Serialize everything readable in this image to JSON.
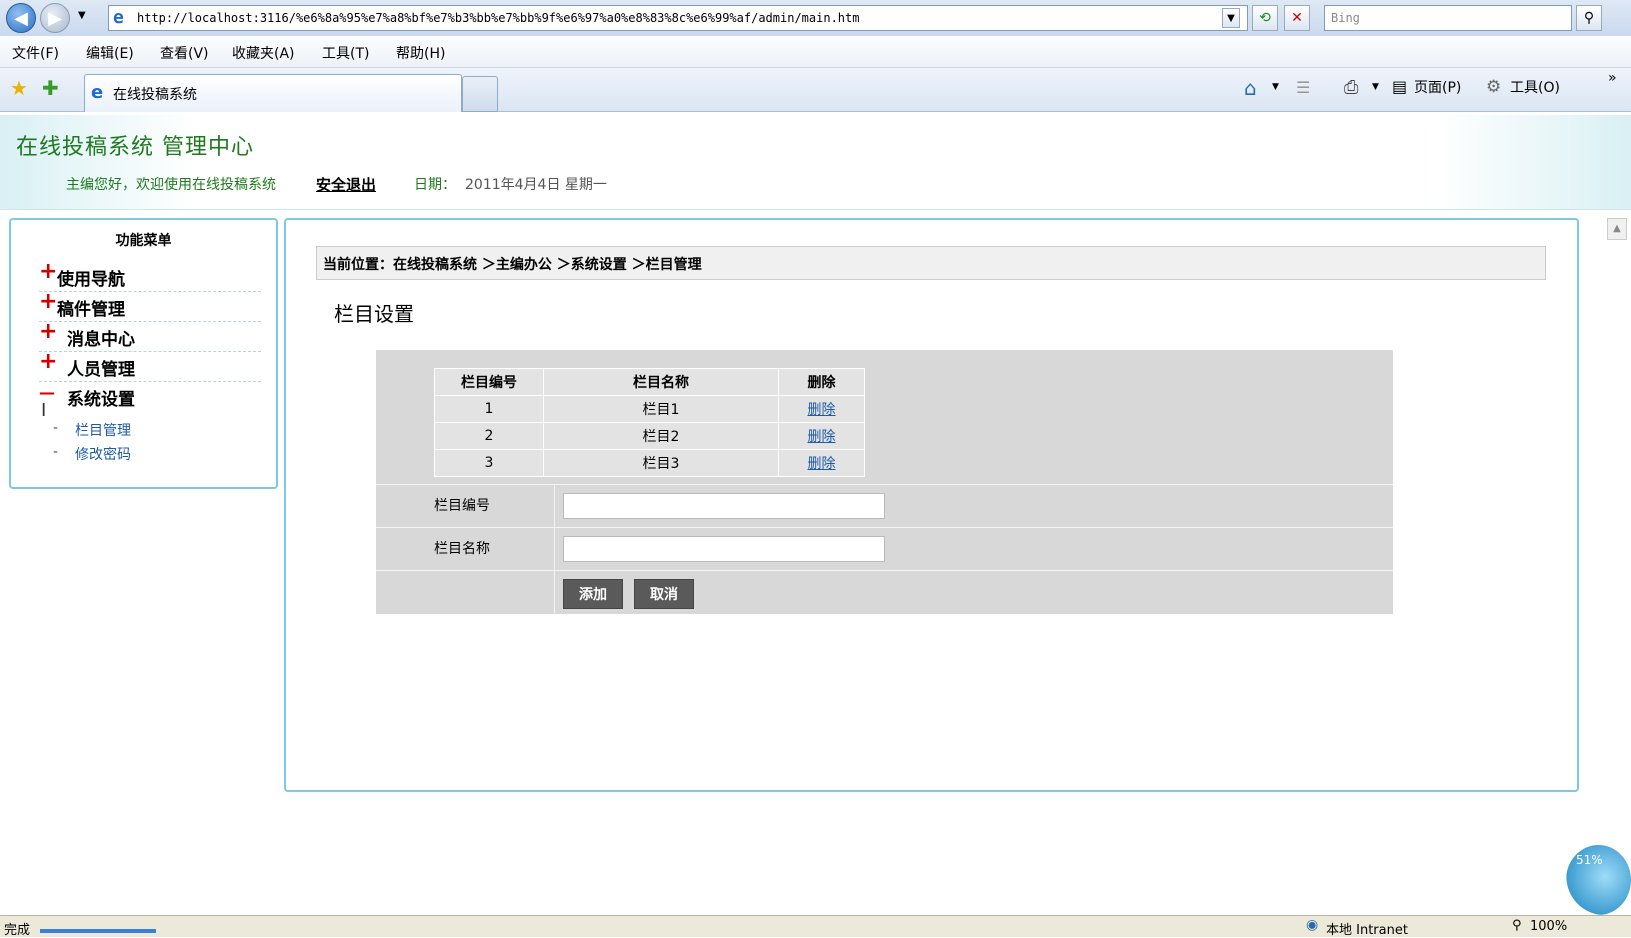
{
  "browser": {
    "url": "http://localhost:3116/%e6%8a%95%e7%a8%bf%e7%b3%bb%e7%bb%9f%e6%97%a0%e8%83%8c%e6%99%af/admin/main.htm",
    "search_placeholder": "Bing",
    "menu": [
      "文件(F)",
      "编辑(E)",
      "查看(V)",
      "收藏夹(A)",
      "工具(T)",
      "帮助(H)"
    ],
    "tab_title": "在线投稿系统",
    "toolbar_page": "页面(P)",
    "toolbar_tools": "工具(O)"
  },
  "header": {
    "title": "在线投稿系统  管理中心",
    "welcome": "主编您好，欢迎使用在线投稿系统",
    "logout": "安全退出",
    "date_label": "日期：",
    "date_value": "2011年4月4日 星期一"
  },
  "sidebar": {
    "title": "功能菜单",
    "groups": [
      {
        "symbol": "+",
        "label": "使用导航"
      },
      {
        "symbol": "+",
        "label": "稿件管理"
      },
      {
        "symbol": "+",
        "label": "消息中心"
      },
      {
        "symbol": "+",
        "label": "人员管理"
      },
      {
        "symbol": "—",
        "label": "系统设置"
      }
    ],
    "subitems": [
      {
        "dash": "-",
        "label": "栏目管理"
      },
      {
        "dash": "-",
        "label": "修改密码"
      }
    ]
  },
  "main": {
    "breadcrumb": "当前位置：在线投稿系统 ＞主编办公 ＞系统设置 ＞栏目管理",
    "section_title": "栏目设置",
    "table": {
      "headers": [
        "栏目编号",
        "栏目名称",
        "删除"
      ],
      "rows": [
        {
          "id": "1",
          "name": "栏目1",
          "action": "删除"
        },
        {
          "id": "2",
          "name": "栏目2",
          "action": "删除"
        },
        {
          "id": "3",
          "name": "栏目3",
          "action": "删除"
        }
      ]
    },
    "form": {
      "id_label": "栏目编号",
      "id_value": "",
      "name_label": "栏目名称",
      "name_value": "",
      "add_button": "添加",
      "cancel_button": "取消"
    }
  },
  "status": {
    "left": "完成",
    "zone": "本地 Intranet",
    "zoom": "100%",
    "widget_percent": "51%"
  }
}
